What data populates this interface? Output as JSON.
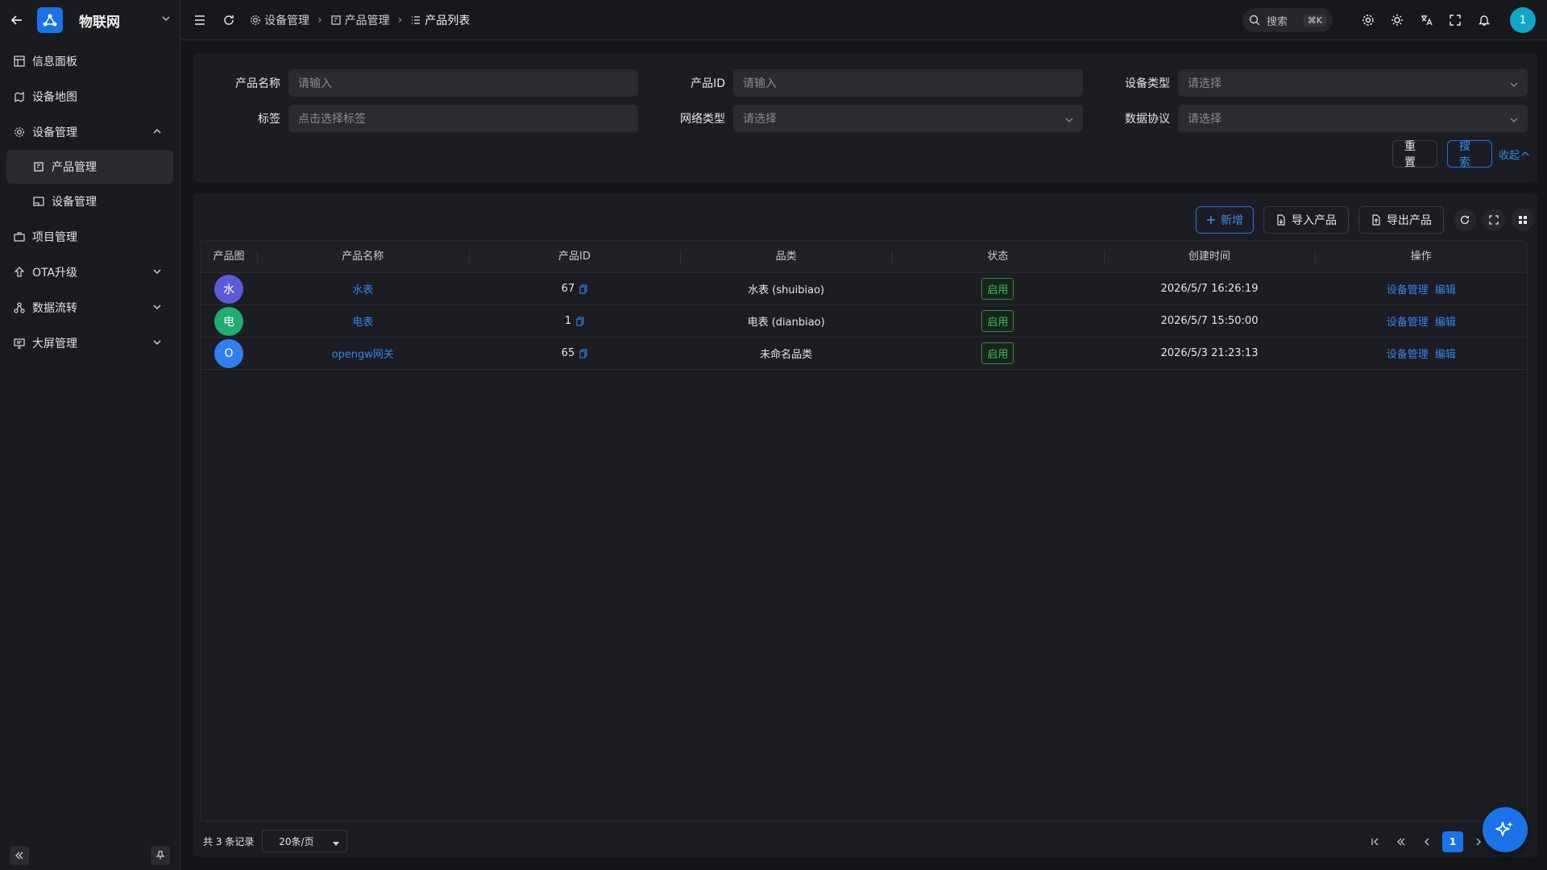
{
  "sidebar": {
    "title": "物联网",
    "items": [
      {
        "label": "信息面板"
      },
      {
        "label": "设备地图"
      },
      {
        "label": "设备管理"
      },
      {
        "label": "产品管理"
      },
      {
        "label": "设备管理"
      },
      {
        "label": "项目管理"
      },
      {
        "label": "OTA升级"
      },
      {
        "label": "数据流转"
      },
      {
        "label": "大屏管理"
      }
    ]
  },
  "header": {
    "breadcrumb": [
      "设备管理",
      "产品管理",
      "产品列表"
    ],
    "search_label": "搜索",
    "search_kbd": "⌘K",
    "avatar_text": "1"
  },
  "filter": {
    "name_label": "产品名称",
    "name_placeholder": "请输入",
    "id_label": "产品ID",
    "id_placeholder": "请输入",
    "type_label": "设备类型",
    "type_placeholder": "请选择",
    "tag_label": "标签",
    "tag_placeholder": "点击选择标签",
    "net_label": "网络类型",
    "net_placeholder": "请选择",
    "proto_label": "数据协议",
    "proto_placeholder": "请选择",
    "reset": "重置",
    "search": "搜索",
    "collapse": "收起"
  },
  "toolbar": {
    "add": "新增",
    "import": "导入产品",
    "export": "导出产品"
  },
  "table": {
    "columns": [
      "产品图",
      "产品名称",
      "产品ID",
      "品类",
      "状态",
      "创建时间",
      "操作"
    ],
    "rows": [
      {
        "avatar": "水",
        "avatar_color": "#5b5bd6",
        "name": "水表",
        "id": "67",
        "category": "水表 (shuibiao)",
        "status": "启用",
        "created": "2026/5/7 16:26:19",
        "op1": "设备管理",
        "op2": "编辑"
      },
      {
        "avatar": "电",
        "avatar_color": "#1fae6e",
        "name": "电表",
        "id": "1",
        "category": "电表 (dianbiao)",
        "status": "启用",
        "created": "2026/5/7 15:50:00",
        "op1": "设备管理",
        "op2": "编辑"
      },
      {
        "avatar": "O",
        "avatar_color": "#2f7ff0",
        "name": "opengw网关",
        "id": "65",
        "category": "未命名品类",
        "status": "启用",
        "created": "2026/5/3 21:23:13",
        "op1": "设备管理",
        "op2": "编辑"
      }
    ]
  },
  "pagination": {
    "total": "共 3 条记录",
    "page_size": "20条/页",
    "current": "1"
  }
}
